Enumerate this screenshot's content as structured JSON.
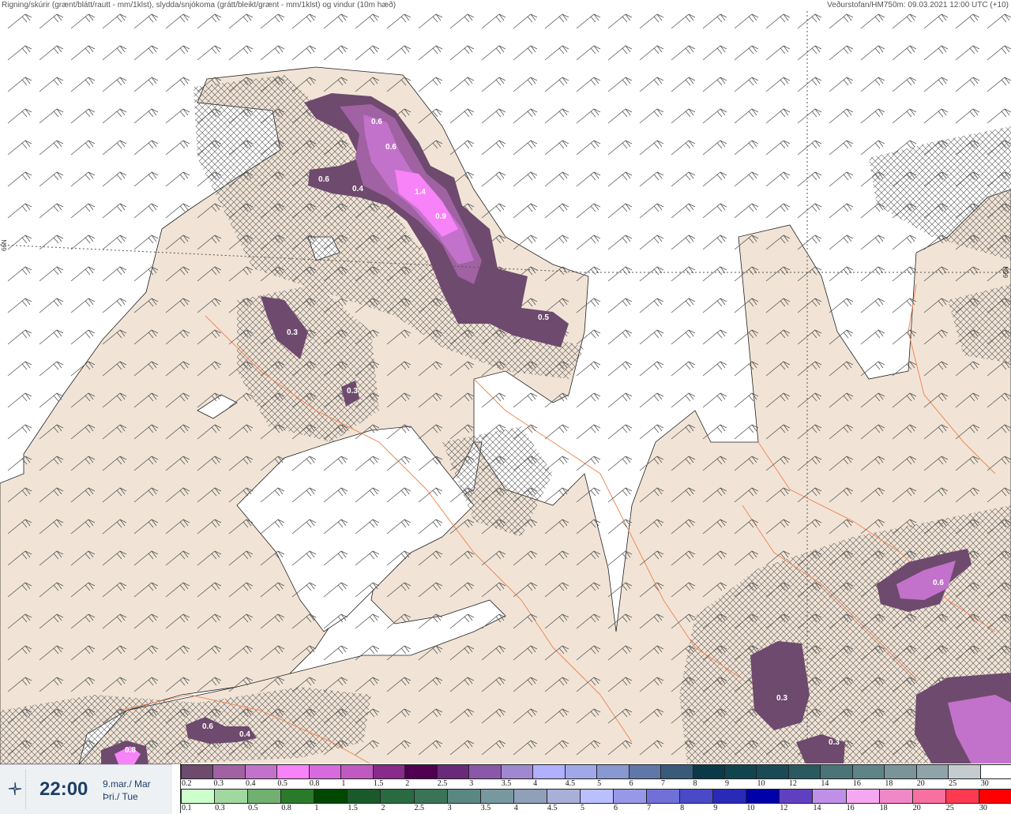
{
  "header": {
    "title": "Rigning/skúrir (grænt/blátt/rautt - mm/1klst), slydda/snjókoma (grátt/bleikt/grænt - mm/1klst) og vindur (10m hæð)",
    "source": "Veðurstofan/HM750m: 09.03.2021 12:00 UTC (+10)"
  },
  "map": {
    "latitude_labels": [
      "66N",
      "66N"
    ],
    "precip_labels": [
      "0.6",
      "0.6",
      "0.6",
      "0.4",
      "1.4",
      "0.9",
      "0.5",
      "0.3",
      "0.3",
      "0.6",
      "0.3",
      "0.3",
      "0.6",
      "0.4",
      "0.8"
    ],
    "colors": {
      "land": "#f1e4d6",
      "sea": "#ffffff",
      "roads": "#f08a5a",
      "coast": "#222222"
    }
  },
  "timebox": {
    "icon": "cycle-icon",
    "time": "22:00",
    "date_line1": "9.mar./ Mar",
    "date_line2": "Þri./ Tue"
  },
  "legend": {
    "snow": {
      "labels": [
        "0.2",
        "0.3",
        "0.4",
        "0.5",
        "0.8",
        "1",
        "1.5",
        "2",
        "2.5",
        "3",
        "3.5",
        "4",
        "4.5",
        "5",
        "6",
        "7",
        "8",
        "9",
        "10",
        "12",
        "14",
        "16",
        "18",
        "20",
        "25",
        "30"
      ],
      "colors": [
        "#6e4a6e",
        "#a062a2",
        "#c272ca",
        "#f882f8",
        "#d86ae0",
        "#c05ac0",
        "#8a2a8a",
        "#500050",
        "#6a2a7a",
        "#8a58a8",
        "#a088d0",
        "#b0b0ff",
        "#a0a8e8",
        "#8898d0",
        "#6078a8",
        "#3a5a7a",
        "#0a3a48",
        "#104550",
        "#1a4a55",
        "#2a5a60",
        "#4a7478",
        "#5e8488",
        "#7a9498",
        "#8ea4a8",
        "#c4ccd0",
        "#ffffff"
      ]
    },
    "rain": {
      "labels": [
        "0.1",
        "0.3",
        "0.5",
        "0.8",
        "1",
        "1.5",
        "2",
        "2.5",
        "3",
        "3.5",
        "4",
        "4.5",
        "5",
        "6",
        "7",
        "8",
        "9",
        "10",
        "12",
        "14",
        "16",
        "18",
        "20",
        "25",
        "30"
      ],
      "colors": [
        "#ccffcc",
        "#a0d8a0",
        "#70b070",
        "#2a7a2a",
        "#004800",
        "#1a5a2a",
        "#2a6a40",
        "#3a7458",
        "#5a8880",
        "#7898a0",
        "#90a0b8",
        "#a8b0d8",
        "#b8c0ff",
        "#9898e8",
        "#7070d8",
        "#4a4ac8",
        "#2a2ab8",
        "#0000a8",
        "#6040c0",
        "#c090e8",
        "#f4a8f0",
        "#f088c8",
        "#f870a0",
        "#ff3a50",
        "#ff0000"
      ]
    }
  }
}
